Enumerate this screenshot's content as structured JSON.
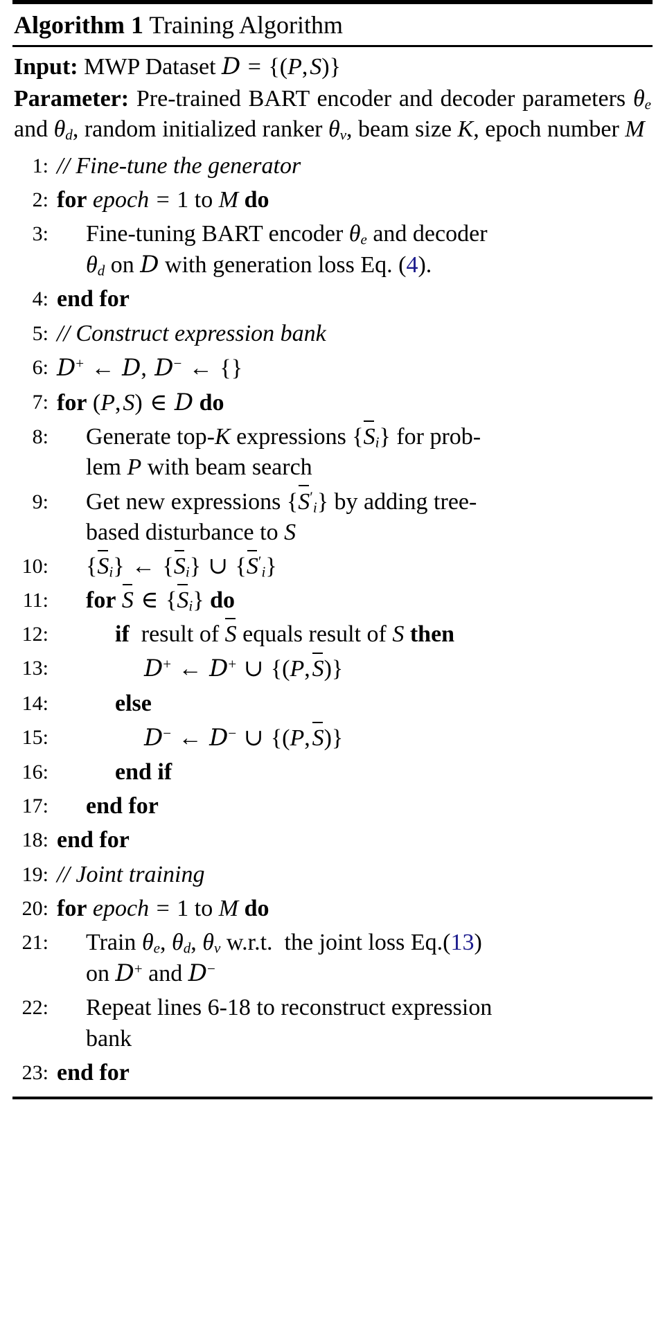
{
  "algorithm": {
    "label": "Algorithm 1",
    "title": "Training Algorithm",
    "accent_ref_color": "#1a1a8c",
    "preamble": [
      {
        "keyword": "Input:",
        "text": "MWP Dataset D = {(P, S)}"
      },
      {
        "keyword": "Parameter:",
        "text": "Pre-trained BART encoder and decoder parameters θe and θd, random initialized ranker θv, beam size K, epoch number M"
      }
    ],
    "lines": [
      {
        "number": "1:",
        "indent": 1,
        "kind": "comment",
        "text": "// Fine-tune the generator"
      },
      {
        "number": "2:",
        "indent": 1,
        "kind": "for",
        "text": "for epoch = 1 to M do"
      },
      {
        "number": "3:",
        "indent": 2,
        "kind": "statement",
        "text": "Fine-tuning BART encoder θe and decoder θd on D with generation loss Eq. (4).",
        "ref": "4"
      },
      {
        "number": "4:",
        "indent": 1,
        "kind": "endfor",
        "text": "end for"
      },
      {
        "number": "5:",
        "indent": 1,
        "kind": "comment",
        "text": "// Construct expression bank"
      },
      {
        "number": "6:",
        "indent": 1,
        "kind": "assign",
        "text": "D+ ← D, D− ← {}"
      },
      {
        "number": "7:",
        "indent": 1,
        "kind": "for",
        "text": "for (P, S) ∈ D do"
      },
      {
        "number": "8:",
        "indent": 2,
        "kind": "statement",
        "text": "Generate top-K expressions {S̄i} for problem P with beam search"
      },
      {
        "number": "9:",
        "indent": 2,
        "kind": "statement",
        "text": "Get new expressions {S̄′i} by adding tree-based disturbance to S"
      },
      {
        "number": "10:",
        "indent": 2,
        "kind": "assign",
        "text": "{S̄i} ← {S̄i} ∪ {S̄′i}"
      },
      {
        "number": "11:",
        "indent": 2,
        "kind": "for",
        "text": "for S̄ ∈ {S̄i} do"
      },
      {
        "number": "12:",
        "indent": 3,
        "kind": "if",
        "text": "if result of S̄ equals result of S then"
      },
      {
        "number": "13:",
        "indent": 4,
        "kind": "assign",
        "text": "D+ ← D+ ∪ {(P, S̄)}"
      },
      {
        "number": "14:",
        "indent": 3,
        "kind": "else",
        "text": "else"
      },
      {
        "number": "15:",
        "indent": 4,
        "kind": "assign",
        "text": "D− ← D− ∪ {(P, S̄)}"
      },
      {
        "number": "16:",
        "indent": 3,
        "kind": "endif",
        "text": "end if"
      },
      {
        "number": "17:",
        "indent": 2,
        "kind": "endfor",
        "text": "end for"
      },
      {
        "number": "18:",
        "indent": 1,
        "kind": "endfor",
        "text": "end for"
      },
      {
        "number": "19:",
        "indent": 1,
        "kind": "comment",
        "text": "// Joint training"
      },
      {
        "number": "20:",
        "indent": 1,
        "kind": "for",
        "text": "for epoch = 1 to M do"
      },
      {
        "number": "21:",
        "indent": 2,
        "kind": "statement",
        "text": "Train θe, θd, θv w.r.t. the joint loss Eq.(13) on D+ and D−",
        "ref": "13"
      },
      {
        "number": "22:",
        "indent": 2,
        "kind": "statement",
        "text": "Repeat lines 6-18 to reconstruct expression bank"
      },
      {
        "number": "23:",
        "indent": 1,
        "kind": "endfor",
        "text": "end for"
      }
    ]
  }
}
